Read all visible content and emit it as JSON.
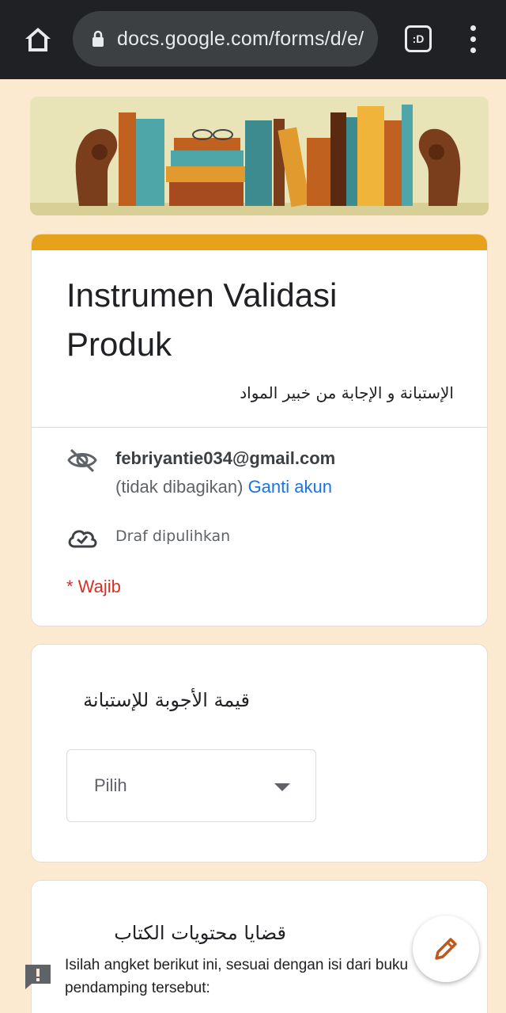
{
  "browser": {
    "url": "docs.google.com/forms/d/e/",
    "tabs_label": ":D",
    "icons": {
      "home": "home-icon",
      "lock": "lock-icon",
      "tabs": "tab-switcher-icon",
      "menu": "more-vert-icon"
    }
  },
  "form": {
    "title_line1": "Instrumen Validasi",
    "title_line2": "Produk",
    "description": "الإستبانة و الإجابة من خبير المواد",
    "account": {
      "email": "febriyantie034@gmail.com",
      "shared_status": "(tidak dibagikan)",
      "switch_account": "Ganti akun"
    },
    "draft_status": "Draf dipulihkan",
    "required_note": "* Wajib",
    "accent_color": "#e6a21a"
  },
  "questions": [
    {
      "title": "قيمة الأجوبة للإستبانة",
      "select_value": "Pilih"
    },
    {
      "title": "قضايا محتويات الكتاب",
      "description": "Isilah angket berikut ini, sesuai dengan isi dari buku pendamping tersebut:"
    }
  ],
  "fab": {
    "icon": "edit-pencil-icon"
  },
  "report": {
    "icon": "report-feedback-icon"
  }
}
